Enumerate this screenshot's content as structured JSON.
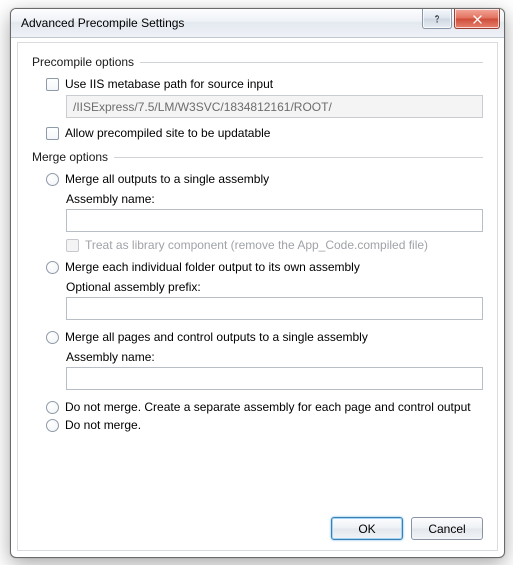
{
  "title": "Advanced Precompile Settings",
  "groups": {
    "precompile": {
      "header": "Precompile options",
      "use_iis_label": "Use IIS metabase path for source input",
      "iis_path_value": "/IISExpress/7.5/LM/W3SVC/1834812161/ROOT/",
      "allow_updatable_label": "Allow precompiled site to be updatable"
    },
    "merge": {
      "header": "Merge options",
      "opt1_label": "Merge all outputs to a single assembly",
      "opt1_sublabel": "Assembly name:",
      "opt1_value": "",
      "opt1_lib_label": "Treat as library component (remove the App_Code.compiled file)",
      "opt2_label": "Merge each individual folder output to its own assembly",
      "opt2_sublabel": "Optional assembly prefix:",
      "opt2_value": "",
      "opt3_label": "Merge all pages and control outputs to a single assembly",
      "opt3_sublabel": "Assembly name:",
      "opt3_value": "",
      "opt4_label": "Do not merge. Create a separate assembly for each page and control output",
      "opt5_label": "Do not merge."
    }
  },
  "buttons": {
    "ok": "OK",
    "cancel": "Cancel"
  }
}
